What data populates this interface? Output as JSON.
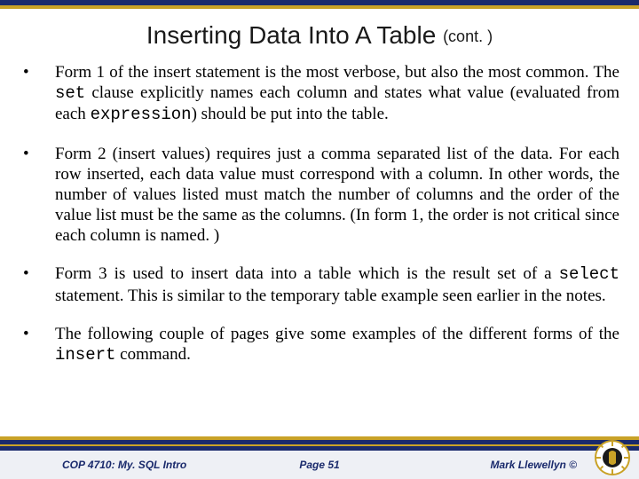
{
  "title": {
    "main": "Inserting Data Into A Table",
    "cont": "(cont. )"
  },
  "bullets": {
    "b1_pre": "Form 1 of the insert statement is the most verbose, but also the most common.  The ",
    "b1_code1": "set",
    "b1_mid": "  clause explicitly names each column and states what value (evaluated from each ",
    "b1_code2": "expression",
    "b1_post": ") should be put into the table.",
    "b2": "Form 2 (insert values) requires just a comma separated list of the data.  For each row inserted, each data value must correspond with a column.  In other words, the number of values listed must match the number of columns and the order of the value list must be the same as the columns.  (In form 1, the order is not critical since each column is named. )",
    "b3_pre": "Form 3 is used to insert data into a table which is the result set of a ",
    "b3_code": "select",
    "b3_post": " statement.  This is similar to the temporary table example seen earlier in the notes.",
    "b4_pre": "The following couple of pages give some examples of the different forms of the ",
    "b4_code": "insert",
    "b4_post": " command."
  },
  "footer": {
    "left": "COP 4710: My. SQL Intro",
    "center": "Page 51",
    "right": "Mark Llewellyn ©"
  }
}
